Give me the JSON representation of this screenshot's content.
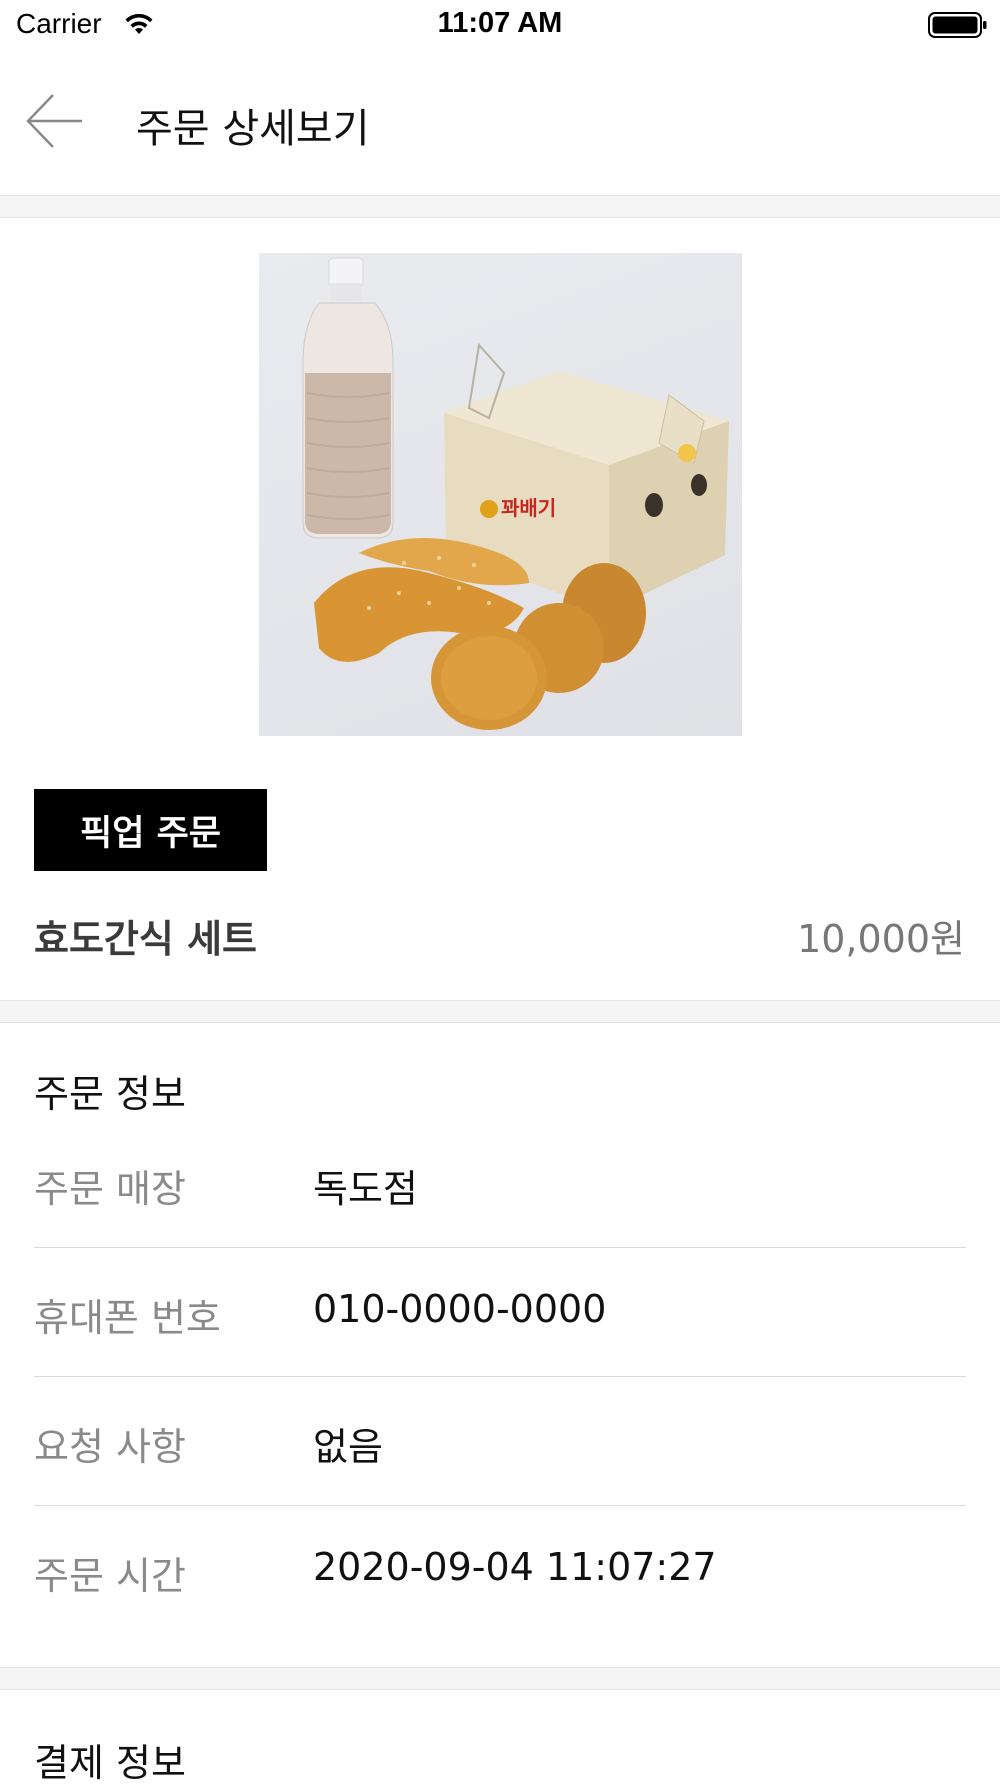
{
  "status_bar": {
    "carrier": "Carrier",
    "time": "11:07 AM"
  },
  "header": {
    "title": "주문 상세보기",
    "back_icon": "arrow-left-icon"
  },
  "product": {
    "order_type_badge": "픽업 주문",
    "name": "효도간식 세트",
    "price": "10,000원"
  },
  "order_info": {
    "title": "주문 정보",
    "rows": [
      {
        "label": "주문 매장",
        "value": "독도점"
      },
      {
        "label": "휴대폰 번호",
        "value": "010-0000-0000"
      },
      {
        "label": "요청 사항",
        "value": "없음"
      },
      {
        "label": "주문 시간",
        "value": "2020-09-04 11:07:27"
      }
    ]
  },
  "payment_info": {
    "title": "결제 정보"
  },
  "colors": {
    "badge_bg": "#000000",
    "badge_text": "#ffffff",
    "label_gray": "#8a8a8a",
    "price_gray": "#777777",
    "band_bg": "#f5f5f5"
  }
}
